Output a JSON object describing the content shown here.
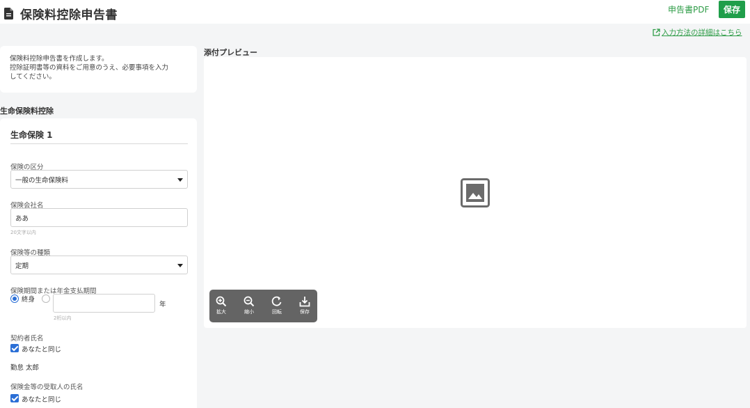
{
  "header": {
    "title": "保険料控除申告書",
    "pdf_label": "申告書PDF",
    "save_label": "保存",
    "help_link": "入力方法の詳細はこちら"
  },
  "intro": {
    "lines": [
      "保険料控除申告書を作成します。",
      "控除証明書等の資料をご用意のうえ、必要事項を入力",
      "してください。"
    ]
  },
  "section": {
    "title": "生命保険料控除",
    "card_title": "生命保険 1",
    "fields": {
      "category_label": "保険の区分",
      "category_value": "一般の生命保険料",
      "company_label": "保険会社名",
      "company_value": "ああ",
      "company_hint": "20文字以内",
      "type_label": "保険等の種類",
      "type_value": "定期",
      "period_label": "保険期間または年金支払期間",
      "period_option_lifetime": "終身",
      "period_unit": "年",
      "period_hint": "2桁以内",
      "contractor_label": "契約者氏名",
      "contractor_same": "あなたと同じ",
      "contractor_name": "勤怠 太郎",
      "recipient_label": "保険金等の受取人の氏名",
      "recipient_same": "あなたと同じ"
    }
  },
  "preview": {
    "title": "添付プレビュー",
    "tools": [
      {
        "label": "拡大",
        "icon": "zoom-in-icon"
      },
      {
        "label": "縮小",
        "icon": "zoom-out-icon"
      },
      {
        "label": "回転",
        "icon": "rotate-icon"
      },
      {
        "label": "保存",
        "icon": "download-icon"
      }
    ]
  },
  "colors": {
    "accent_green": "#1f9e4a",
    "checkbox_blue": "#2b6fd6",
    "toolbar_gray": "#646464"
  }
}
